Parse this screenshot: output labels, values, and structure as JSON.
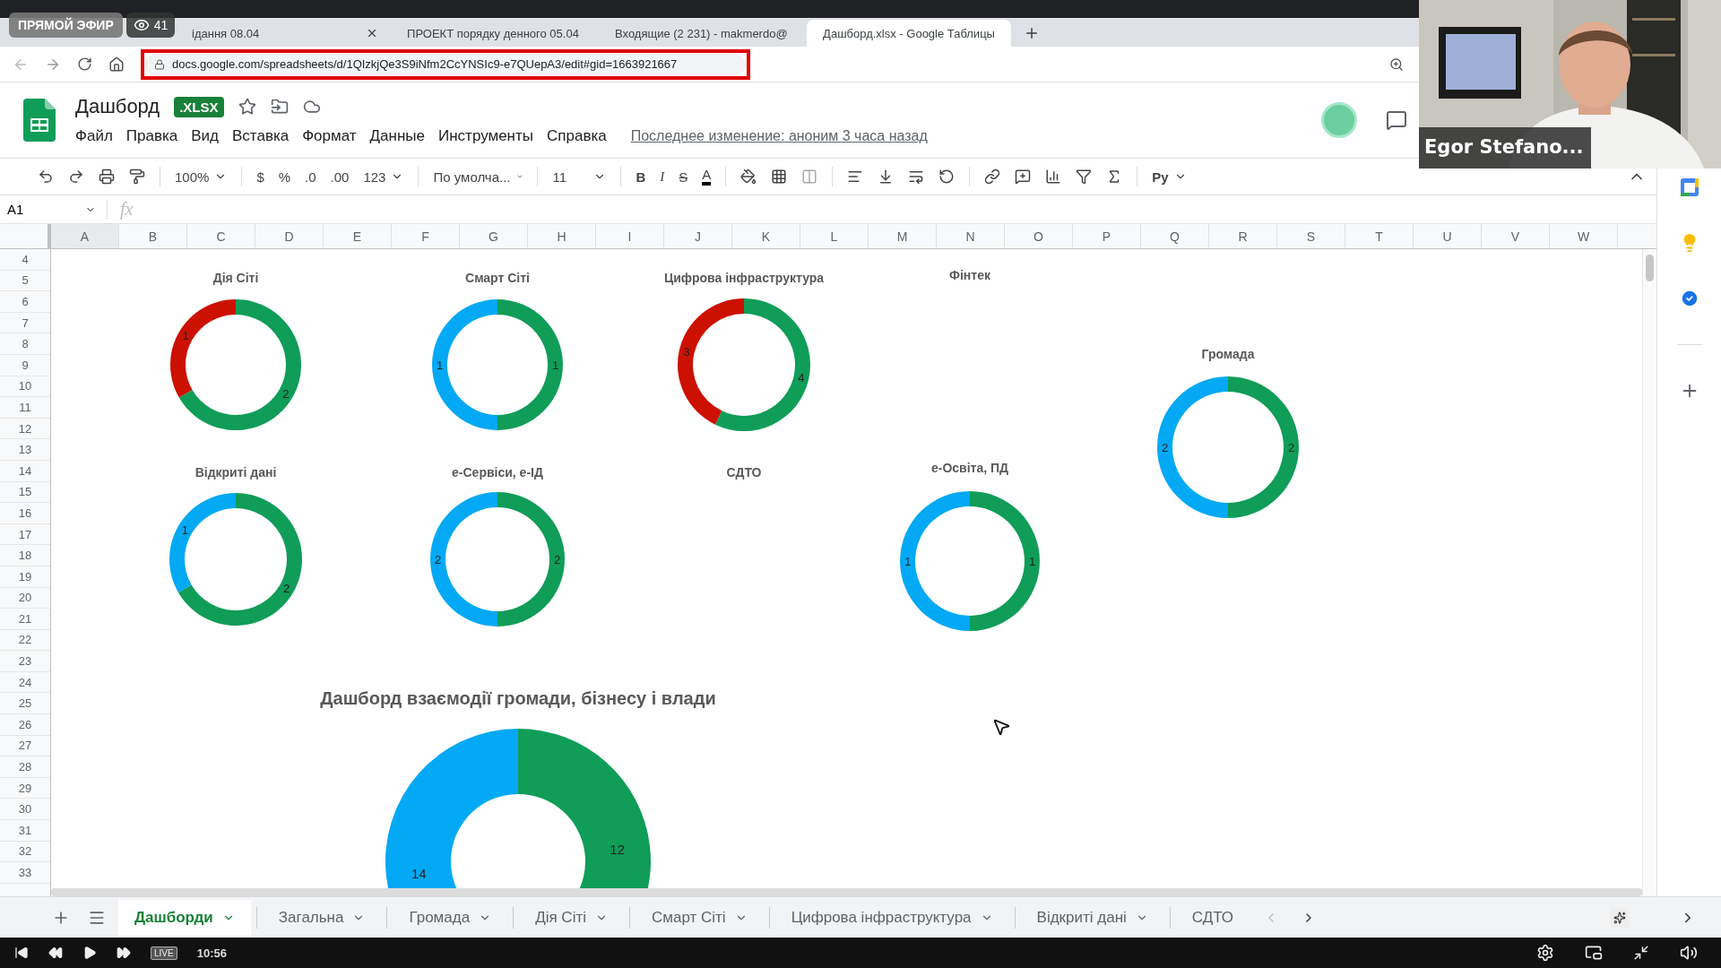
{
  "live_badge": {
    "label": "ПРЯМОЙ ЭФИР",
    "viewers": "41"
  },
  "browser_tabs": [
    {
      "title": "ідання 08.04",
      "kind": "none",
      "selected": false
    },
    {
      "title": "ПРОЕКТ порядку денного 05.04",
      "kind": "docs",
      "selected": false
    },
    {
      "title": "Входящие (2 231) - makmerdo@",
      "kind": "gmail",
      "selected": false
    },
    {
      "title": "Дашборд.xlsx - Google Таблицы",
      "kind": "sheets",
      "selected": true
    }
  ],
  "address_bar": {
    "url": "docs.google.com/spreadsheets/d/1QIzkjQe3S9iNfm2CcYNSIc9-e7QUepA3/edit#gid=1663921667"
  },
  "document": {
    "title": "Дашборд",
    "format_badge": ".XLSX",
    "menu": [
      "Файл",
      "Правка",
      "Вид",
      "Вставка",
      "Формат",
      "Данные",
      "Инструменты",
      "Справка"
    ],
    "last_edit": "Последнее изменение: аноним 3 часа назад"
  },
  "toolbar": {
    "zoom": "100%",
    "currency": "$",
    "percent": "%",
    "decrease_decimals": ".0",
    "increase_decimals": ".00",
    "more_formats": "123",
    "font": "По умолча...",
    "font_size": "11",
    "bold": "B",
    "italic": "I",
    "strikethrough": "S",
    "text_color": "A",
    "input_tools": "Ру"
  },
  "formula_bar": {
    "cell": "A1",
    "function_label": "fx"
  },
  "sheet": {
    "columns": [
      {
        "label": "A",
        "selected": true
      },
      {
        "label": "B",
        "selected": false
      },
      {
        "label": "C",
        "selected": false
      },
      {
        "label": "D",
        "selected": false
      },
      {
        "label": "E",
        "selected": false
      },
      {
        "label": "F",
        "selected": false
      },
      {
        "label": "G",
        "selected": false
      },
      {
        "label": "H",
        "selected": false
      },
      {
        "label": "I",
        "selected": false
      },
      {
        "label": "J",
        "selected": false
      },
      {
        "label": "K",
        "selected": false
      },
      {
        "label": "L",
        "selected": false
      },
      {
        "label": "M",
        "selected": false
      },
      {
        "label": "N",
        "selected": false
      },
      {
        "label": "O",
        "selected": false
      },
      {
        "label": "P",
        "selected": false
      },
      {
        "label": "Q",
        "selected": false
      },
      {
        "label": "R",
        "selected": false
      },
      {
        "label": "S",
        "selected": false
      },
      {
        "label": "T",
        "selected": false
      },
      {
        "label": "U",
        "selected": false
      },
      {
        "label": "V",
        "selected": false
      },
      {
        "label": "W",
        "selected": false
      }
    ],
    "rows": [
      "4",
      "5",
      "6",
      "7",
      "8",
      "9",
      "10",
      "11",
      "12",
      "13",
      "14",
      "15",
      "16",
      "17",
      "18",
      "19",
      "20",
      "21",
      "22",
      "23",
      "24",
      "25",
      "26",
      "27",
      "28",
      "29",
      "30",
      "31",
      "32",
      "33"
    ],
    "charts": [
      {
        "kind": "donut",
        "chart_data": {
          "type": "donut",
          "title": "Дія Сіті",
          "values": [
            2,
            1
          ],
          "colors": [
            "#0f9d58",
            "#cc1100"
          ],
          "data_labels": true
        }
      },
      {
        "kind": "donut",
        "chart_data": {
          "type": "donut",
          "title": "Смарт Сіті",
          "values": [
            1,
            1
          ],
          "colors": [
            "#0f9d58",
            "#03a9f4"
          ],
          "data_labels": true
        }
      },
      {
        "kind": "donut",
        "chart_data": {
          "type": "donut",
          "title": "Цифрова інфраструктура",
          "values": [
            4,
            3
          ],
          "colors": [
            "#0f9d58",
            "#cc1100"
          ],
          "data_labels": true
        }
      },
      {
        "kind": "empty",
        "title": "Фінтек"
      },
      {
        "kind": "donut",
        "chart_data": {
          "type": "donut",
          "title": "Громада",
          "values": [
            2,
            2
          ],
          "colors": [
            "#0f9d58",
            "#03a9f4"
          ],
          "data_labels": true
        }
      },
      {
        "kind": "donut",
        "chart_data": {
          "type": "donut",
          "title": "Відкриті дані",
          "values": [
            2,
            1
          ],
          "colors": [
            "#0f9d58",
            "#03a9f4"
          ],
          "data_labels": true
        }
      },
      {
        "kind": "donut",
        "chart_data": {
          "type": "donut",
          "title": "е-Сервіси, е-ІД",
          "values": [
            2,
            2
          ],
          "colors": [
            "#0f9d58",
            "#03a9f4"
          ],
          "data_labels": true
        }
      },
      {
        "kind": "empty",
        "title": "СДТО"
      },
      {
        "kind": "donut",
        "chart_data": {
          "type": "donut",
          "title": "е-Освіта, ПД",
          "values": [
            1,
            1
          ],
          "colors": [
            "#0f9d58",
            "#03a9f4"
          ],
          "data_labels": true
        }
      },
      {
        "kind": "donut",
        "chart_data": {
          "type": "donut",
          "title": "Дашборд взаємодії громади, бізнесу і влади",
          "values": [
            12,
            14
          ],
          "colors": [
            "#0f9d58",
            "#03a9f4"
          ],
          "data_labels": true
        }
      }
    ]
  },
  "sheet_tabs": [
    {
      "label": "Дашборди",
      "selected": true,
      "has_menu": true
    },
    {
      "label": "Загальна",
      "selected": false,
      "has_menu": true
    },
    {
      "label": "Громада",
      "selected": false,
      "has_menu": true
    },
    {
      "label": "Дія Сіті",
      "selected": false,
      "has_menu": true
    },
    {
      "label": "Смарт Сіті",
      "selected": false,
      "has_menu": true
    },
    {
      "label": "Цифрова інфраструктура",
      "selected": false,
      "has_menu": true
    },
    {
      "label": "Відкриті дані",
      "selected": false,
      "has_menu": true
    },
    {
      "label": "СДТО",
      "selected": false,
      "has_menu": false
    }
  ],
  "video": {
    "participant": "Egor Stefano..."
  },
  "player": {
    "live": "LIVE",
    "time": "10:56"
  }
}
